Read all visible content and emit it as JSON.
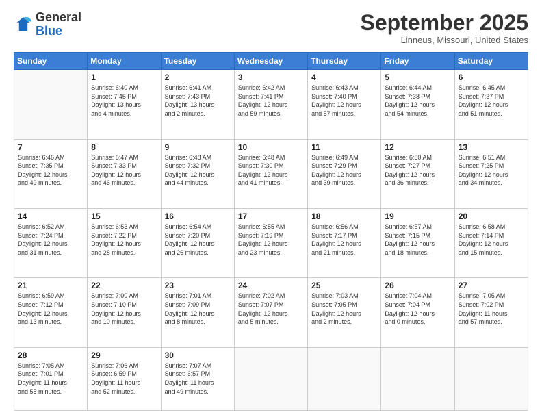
{
  "logo": {
    "general": "General",
    "blue": "Blue"
  },
  "header": {
    "month": "September 2025",
    "location": "Linneus, Missouri, United States"
  },
  "weekdays": [
    "Sunday",
    "Monday",
    "Tuesday",
    "Wednesday",
    "Thursday",
    "Friday",
    "Saturday"
  ],
  "weeks": [
    [
      {
        "day": "",
        "info": ""
      },
      {
        "day": "1",
        "info": "Sunrise: 6:40 AM\nSunset: 7:45 PM\nDaylight: 13 hours\nand 4 minutes."
      },
      {
        "day": "2",
        "info": "Sunrise: 6:41 AM\nSunset: 7:43 PM\nDaylight: 13 hours\nand 2 minutes."
      },
      {
        "day": "3",
        "info": "Sunrise: 6:42 AM\nSunset: 7:41 PM\nDaylight: 12 hours\nand 59 minutes."
      },
      {
        "day": "4",
        "info": "Sunrise: 6:43 AM\nSunset: 7:40 PM\nDaylight: 12 hours\nand 57 minutes."
      },
      {
        "day": "5",
        "info": "Sunrise: 6:44 AM\nSunset: 7:38 PM\nDaylight: 12 hours\nand 54 minutes."
      },
      {
        "day": "6",
        "info": "Sunrise: 6:45 AM\nSunset: 7:37 PM\nDaylight: 12 hours\nand 51 minutes."
      }
    ],
    [
      {
        "day": "7",
        "info": "Sunrise: 6:46 AM\nSunset: 7:35 PM\nDaylight: 12 hours\nand 49 minutes."
      },
      {
        "day": "8",
        "info": "Sunrise: 6:47 AM\nSunset: 7:33 PM\nDaylight: 12 hours\nand 46 minutes."
      },
      {
        "day": "9",
        "info": "Sunrise: 6:48 AM\nSunset: 7:32 PM\nDaylight: 12 hours\nand 44 minutes."
      },
      {
        "day": "10",
        "info": "Sunrise: 6:48 AM\nSunset: 7:30 PM\nDaylight: 12 hours\nand 41 minutes."
      },
      {
        "day": "11",
        "info": "Sunrise: 6:49 AM\nSunset: 7:29 PM\nDaylight: 12 hours\nand 39 minutes."
      },
      {
        "day": "12",
        "info": "Sunrise: 6:50 AM\nSunset: 7:27 PM\nDaylight: 12 hours\nand 36 minutes."
      },
      {
        "day": "13",
        "info": "Sunrise: 6:51 AM\nSunset: 7:25 PM\nDaylight: 12 hours\nand 34 minutes."
      }
    ],
    [
      {
        "day": "14",
        "info": "Sunrise: 6:52 AM\nSunset: 7:24 PM\nDaylight: 12 hours\nand 31 minutes."
      },
      {
        "day": "15",
        "info": "Sunrise: 6:53 AM\nSunset: 7:22 PM\nDaylight: 12 hours\nand 28 minutes."
      },
      {
        "day": "16",
        "info": "Sunrise: 6:54 AM\nSunset: 7:20 PM\nDaylight: 12 hours\nand 26 minutes."
      },
      {
        "day": "17",
        "info": "Sunrise: 6:55 AM\nSunset: 7:19 PM\nDaylight: 12 hours\nand 23 minutes."
      },
      {
        "day": "18",
        "info": "Sunrise: 6:56 AM\nSunset: 7:17 PM\nDaylight: 12 hours\nand 21 minutes."
      },
      {
        "day": "19",
        "info": "Sunrise: 6:57 AM\nSunset: 7:15 PM\nDaylight: 12 hours\nand 18 minutes."
      },
      {
        "day": "20",
        "info": "Sunrise: 6:58 AM\nSunset: 7:14 PM\nDaylight: 12 hours\nand 15 minutes."
      }
    ],
    [
      {
        "day": "21",
        "info": "Sunrise: 6:59 AM\nSunset: 7:12 PM\nDaylight: 12 hours\nand 13 minutes."
      },
      {
        "day": "22",
        "info": "Sunrise: 7:00 AM\nSunset: 7:10 PM\nDaylight: 12 hours\nand 10 minutes."
      },
      {
        "day": "23",
        "info": "Sunrise: 7:01 AM\nSunset: 7:09 PM\nDaylight: 12 hours\nand 8 minutes."
      },
      {
        "day": "24",
        "info": "Sunrise: 7:02 AM\nSunset: 7:07 PM\nDaylight: 12 hours\nand 5 minutes."
      },
      {
        "day": "25",
        "info": "Sunrise: 7:03 AM\nSunset: 7:05 PM\nDaylight: 12 hours\nand 2 minutes."
      },
      {
        "day": "26",
        "info": "Sunrise: 7:04 AM\nSunset: 7:04 PM\nDaylight: 12 hours\nand 0 minutes."
      },
      {
        "day": "27",
        "info": "Sunrise: 7:05 AM\nSunset: 7:02 PM\nDaylight: 11 hours\nand 57 minutes."
      }
    ],
    [
      {
        "day": "28",
        "info": "Sunrise: 7:05 AM\nSunset: 7:01 PM\nDaylight: 11 hours\nand 55 minutes."
      },
      {
        "day": "29",
        "info": "Sunrise: 7:06 AM\nSunset: 6:59 PM\nDaylight: 11 hours\nand 52 minutes."
      },
      {
        "day": "30",
        "info": "Sunrise: 7:07 AM\nSunset: 6:57 PM\nDaylight: 11 hours\nand 49 minutes."
      },
      {
        "day": "",
        "info": ""
      },
      {
        "day": "",
        "info": ""
      },
      {
        "day": "",
        "info": ""
      },
      {
        "day": "",
        "info": ""
      }
    ]
  ]
}
